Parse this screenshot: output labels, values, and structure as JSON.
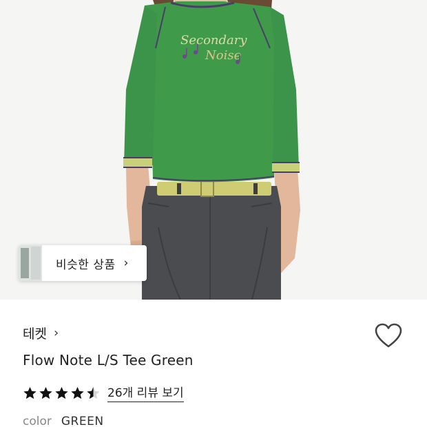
{
  "hero": {
    "shirt_print_line1": "Secondary",
    "shirt_print_line2": "Noise",
    "colors": {
      "shirt": "#3f9a4a",
      "pants": "#4a4c50",
      "belt": "#cfcd73",
      "trim": "#4b3d6a"
    }
  },
  "similar_products": {
    "label": "비슷한 상품",
    "chevron": "›",
    "icon": "chevron-right-icon"
  },
  "product": {
    "brand": "테켓",
    "brand_chevron": "›",
    "title": "Flow Note L/S Tee Green",
    "rating": 4.5,
    "rating_max": 5,
    "review_link": "26개 리뷰 보기",
    "color_label": "color",
    "color_value": "GREEN",
    "wishlist_icon": "heart-outline-icon"
  }
}
